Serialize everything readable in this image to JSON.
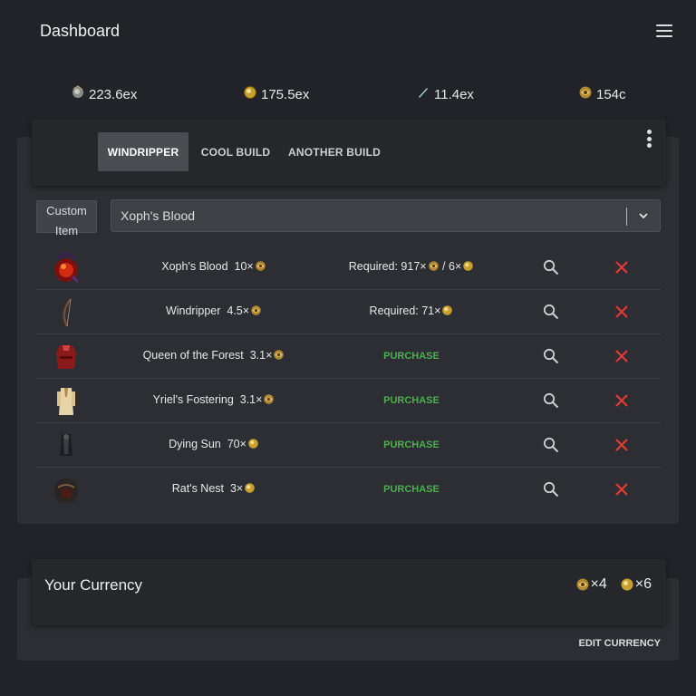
{
  "header": {
    "title": "Dashboard",
    "menu_icon": "hamburger-menu-icon"
  },
  "prices": [
    {
      "icon": "divine-orb-icon",
      "value": "223.6ex"
    },
    {
      "icon": "exalted-orb-icon",
      "value": "175.5ex"
    },
    {
      "icon": "mirror-shard-icon",
      "value": "11.4ex"
    },
    {
      "icon": "chaos-orb-icon",
      "value": "154c"
    }
  ],
  "builds": {
    "tabs": [
      "WINDRIPPER",
      "COOL BUILD",
      "ANOTHER BUILD"
    ],
    "active_tab": "WINDRIPPER",
    "more_icon": "more-vertical-icon"
  },
  "item_picker": {
    "custom_label_line1": "Custom",
    "custom_label_line2": "Item",
    "selected": "Xoph's Blood"
  },
  "items": [
    {
      "name": "Xoph's Blood",
      "price": "10×",
      "status_type": "required",
      "status": "Required: 917×",
      "status_extra": " / 6×"
    },
    {
      "name": "Windripper",
      "price": "4.5×",
      "status_type": "required",
      "status": "Required: 71×",
      "status_extra": ""
    },
    {
      "name": "Queen of the Forest",
      "price": "3.1×",
      "status_type": "purchase",
      "status": "PURCHASE",
      "status_extra": ""
    },
    {
      "name": "Yriel's Fostering",
      "price": "3.1×",
      "status_type": "purchase",
      "status": "PURCHASE",
      "status_extra": ""
    },
    {
      "name": "Dying Sun",
      "price": "70×",
      "status_type": "purchase",
      "status": "PURCHASE",
      "status_extra": ""
    },
    {
      "name": "Rat's Nest",
      "price": "3×",
      "status_type": "purchase",
      "status": "PURCHASE",
      "status_extra": ""
    }
  ],
  "currency": {
    "title": "Your Currency",
    "holdings": [
      {
        "icon": "chaos-orb-icon",
        "amount": "×4"
      },
      {
        "icon": "exalted-orb-icon",
        "amount": "×6"
      }
    ],
    "edit_label": "EDIT CURRENCY"
  },
  "colors": {
    "accent_green": "#4caf50",
    "remove_red": "#e53935",
    "background": "#222328"
  }
}
